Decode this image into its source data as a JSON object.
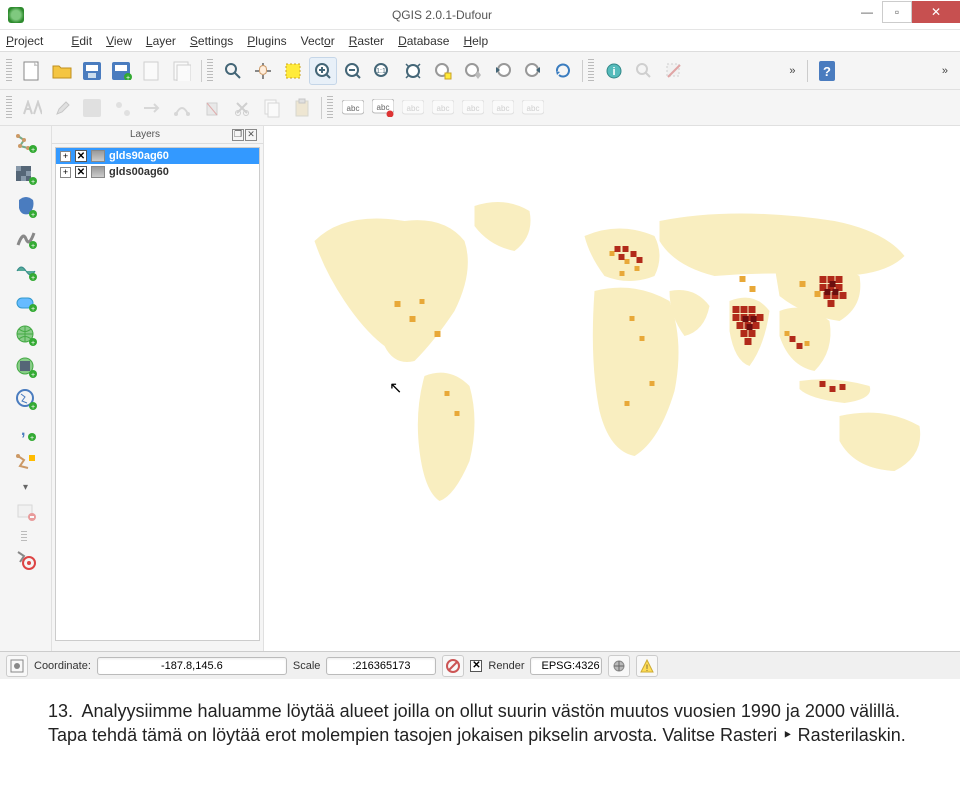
{
  "window": {
    "title": "QGIS 2.0.1-Dufour"
  },
  "menu": {
    "items": [
      "Project",
      "Edit",
      "View",
      "Layer",
      "Settings",
      "Plugins",
      "Vector",
      "Raster",
      "Database",
      "Help"
    ]
  },
  "layers_panel": {
    "title": "Layers",
    "items": [
      {
        "name": "glds90ag60",
        "checked": true,
        "selected": true
      },
      {
        "name": "glds00ag60",
        "checked": true,
        "selected": false
      }
    ]
  },
  "statusbar": {
    "coord_label": "Coordinate:",
    "coord_value": "-187.8,145.6",
    "scale_label": "Scale",
    "scale_value": ":216365173",
    "render_label": "Render",
    "epsg": "EPSG:4326"
  },
  "body": {
    "number": "13.",
    "text": "Analyysiimme haluamme löytää alueet joilla on ollut suurin västön muutos vuosien 1990 ja 2000 välillä. Tapa tehdä tämä on löytää erot molempien tasojen jokaisen pikselin arvosta. Valitse Rasteri ‣ Rasterilaskin."
  }
}
